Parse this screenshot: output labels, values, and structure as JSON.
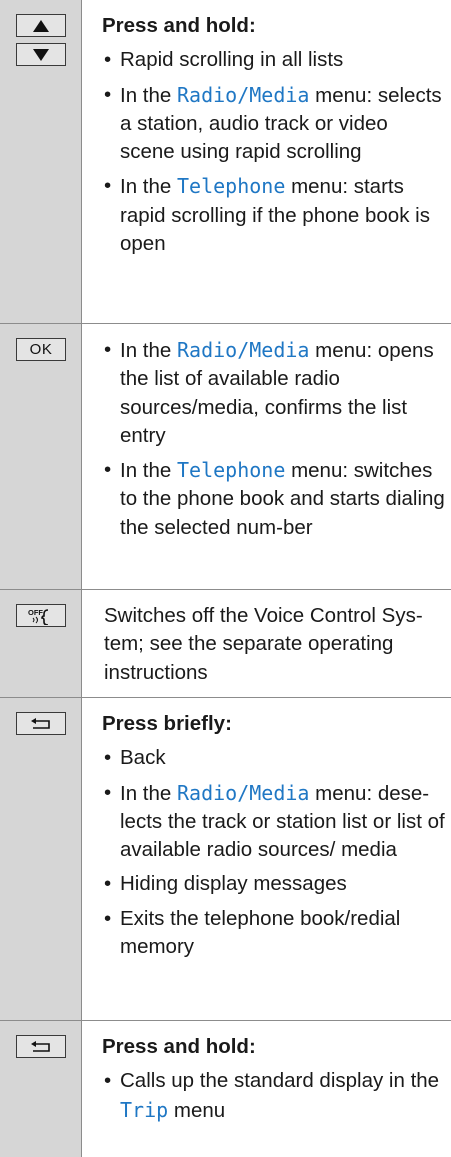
{
  "rows": [
    {
      "keys": [
        "up-arrow-icon",
        "down-arrow-icon"
      ],
      "heading": "Press and hold:",
      "bullets": {
        "b0": "Rapid scrolling in all lists",
        "b1_pre": "In the ",
        "b1_m1": "Radio",
        "b1_sep": "/",
        "b1_m2": "Media",
        "b1_post": " menu: selects a station, audio track or video scene using rapid scrolling",
        "b2_pre": "In the ",
        "b2_m1": "Telephone",
        "b2_post": " menu: starts rapid scrolling if the phone book is open"
      }
    },
    {
      "key_label": "OK",
      "bullets": {
        "b0_pre": "In the ",
        "b0_m1": "Radio",
        "b0_sep": "/",
        "b0_m2": "Media",
        "b0_post": " menu: opens the list of available radio sources/media, confirms the list entry",
        "b1_pre": "In the ",
        "b1_m1": "Telephone",
        "b1_post": " menu: switches to the phone book and starts dialing the selected num-ber"
      }
    },
    {
      "key_label": "OFF",
      "key_icon": "voice-control-off-icon",
      "text": "Switches off the Voice Control Sys-tem; see the separate operating instructions"
    },
    {
      "key_icon": "back-icon",
      "heading": "Press briefly:",
      "bullets": {
        "b0": "Back",
        "b1_pre": "In the ",
        "b1_m1": "Radio",
        "b1_sep": "/",
        "b1_m2": "Media",
        "b1_post": " menu: dese-lects the track or station list or list of available radio sources/ media",
        "b2": "Hiding display messages",
        "b3": "Exits the telephone book/redial memory"
      }
    },
    {
      "key_icon": "back-icon",
      "heading": "Press and hold:",
      "bullets": {
        "b0_pre": "Calls up the standard display in the ",
        "b0_m1": "Trip",
        "b0_post": " menu"
      }
    }
  ],
  "colors": {
    "menu_link": "#1f77c4",
    "key_column": "#d6d6d6",
    "rule": "#8c8c8c"
  }
}
